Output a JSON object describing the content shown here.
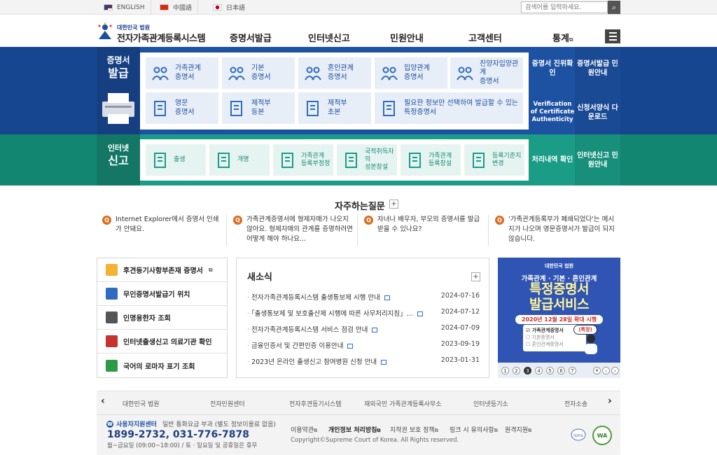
{
  "langs": [
    {
      "label": "ENGLISH"
    },
    {
      "label": "中國語"
    },
    {
      "label": "日本語"
    }
  ],
  "search": {
    "placeholder": "검색어를 입력하세요."
  },
  "logo": {
    "small": "대한민국 법원",
    "title": "전자가족관계등록시스템"
  },
  "gnb": [
    "증명서발급",
    "인터넷신고",
    "민원안내",
    "고객센터",
    "통계"
  ],
  "cert": {
    "title1": "증명서",
    "title2": "발급",
    "cards": [
      "가족관계\n증명서",
      "기본\n증명서",
      "혼인관계\n증명서",
      "입양관계\n증명서",
      "친양자입양관계\n증명서",
      "영문\n증명서",
      "제적부\n등본",
      "제적부\n초본",
      "필요한 정보만 선택하여 발급할 수 있는\n특정증명서"
    ],
    "side": [
      "증명서\n진위확인",
      "증명서발급\n민원안내",
      "Verification of\nCertificate\nAuthenticity",
      "신청서양식\n다운로드"
    ]
  },
  "report": {
    "title1": "인터넷",
    "title2": "신고",
    "cards": [
      "출생",
      "개명",
      "가족관계\n등록부정정",
      "국적취득자의\n성본창설",
      "가족관계\n등록창설",
      "등록기준지\n변경"
    ],
    "side": [
      "처리내역\n확인",
      "인터넷신고\n민원안내"
    ]
  },
  "faq": {
    "title": "자주하는질문",
    "items": [
      "Internet Explorer에서 증명서 인쇄가 안돼요.",
      "가족관계증명서에 형제자매가 나오지 않아요. 형제자매의 관계를 증명하려면 어떻게 해야 하나요...",
      "자녀나 배우자, 부모의 증명서를 발급받을 수 있나요?",
      "'가족관계등록부가 폐쇄되었다'는 메시지가 나오며 영문증명서가 발급이 되지 않습니다."
    ]
  },
  "quick": [
    "후견등기사항부존재 증명서",
    "무인증명서발급기 위치",
    "인명용한자 조회",
    "인터넷출생신고 의료기관 확인",
    "국어의 로마자 표기 조회"
  ],
  "notice": {
    "title": "새소식",
    "rows": [
      {
        "text": "전자가족관계등록시스템 출생통보제 시행 안내",
        "date": "2024-07-16"
      },
      {
        "text": "「출생통보제 및 보호출산제 시행에 따른 사무처리지침」...",
        "date": "2024-07-12"
      },
      {
        "text": "전자가족관계등록시스템 서비스 점검 안내",
        "date": "2024-07-09"
      },
      {
        "text": "금융인증서 및 간편인증 이용안내",
        "date": "2023-09-19"
      },
      {
        "text": "2023년 온라인 출생신고 참여병원 신청 안내",
        "date": "2023-01-31"
      }
    ]
  },
  "banner": {
    "org": "대한민국 법원",
    "sub": "가족관계 · 기본 · 혼인관계",
    "big1": "특정증명서",
    "big2": "발급서비스",
    "date": "2020년 12월 28일 확대 시행",
    "check1": "가족관계증명서",
    "check2": "기본증명서",
    "check3": "혼인관계증명서",
    "pick": "특정",
    "pages": [
      "1",
      "2",
      "3",
      "4",
      "5",
      "6",
      "7"
    ],
    "active": "3"
  },
  "footlinks": [
    "대한민국 법원",
    "전자민원센터",
    "전자후견등기시스템",
    "재외국민 가족관계등록사무소",
    "인터넷등기소",
    "전자소송"
  ],
  "center": {
    "title": "사용자지원센터",
    "note": "일반 통화요금 부과 (별도 정보이용료 없음)",
    "phone": "1899-2732, 031-776-7878",
    "hours": "월~금요일 (09:00~18:00) / 토 · 일요일 및 공휴일은 휴무"
  },
  "policy": [
    "이용약관",
    "개인정보 처리방침",
    "지작권 보호 정책",
    "링크 시 유의사항",
    "원격지원"
  ],
  "copyright": "Copyright©Supreme Court of Korea. All Rights reserved.",
  "colors": {
    "blue": "#1d52a3",
    "teal": "#1a9c86",
    "orange": "#d96d1f"
  }
}
